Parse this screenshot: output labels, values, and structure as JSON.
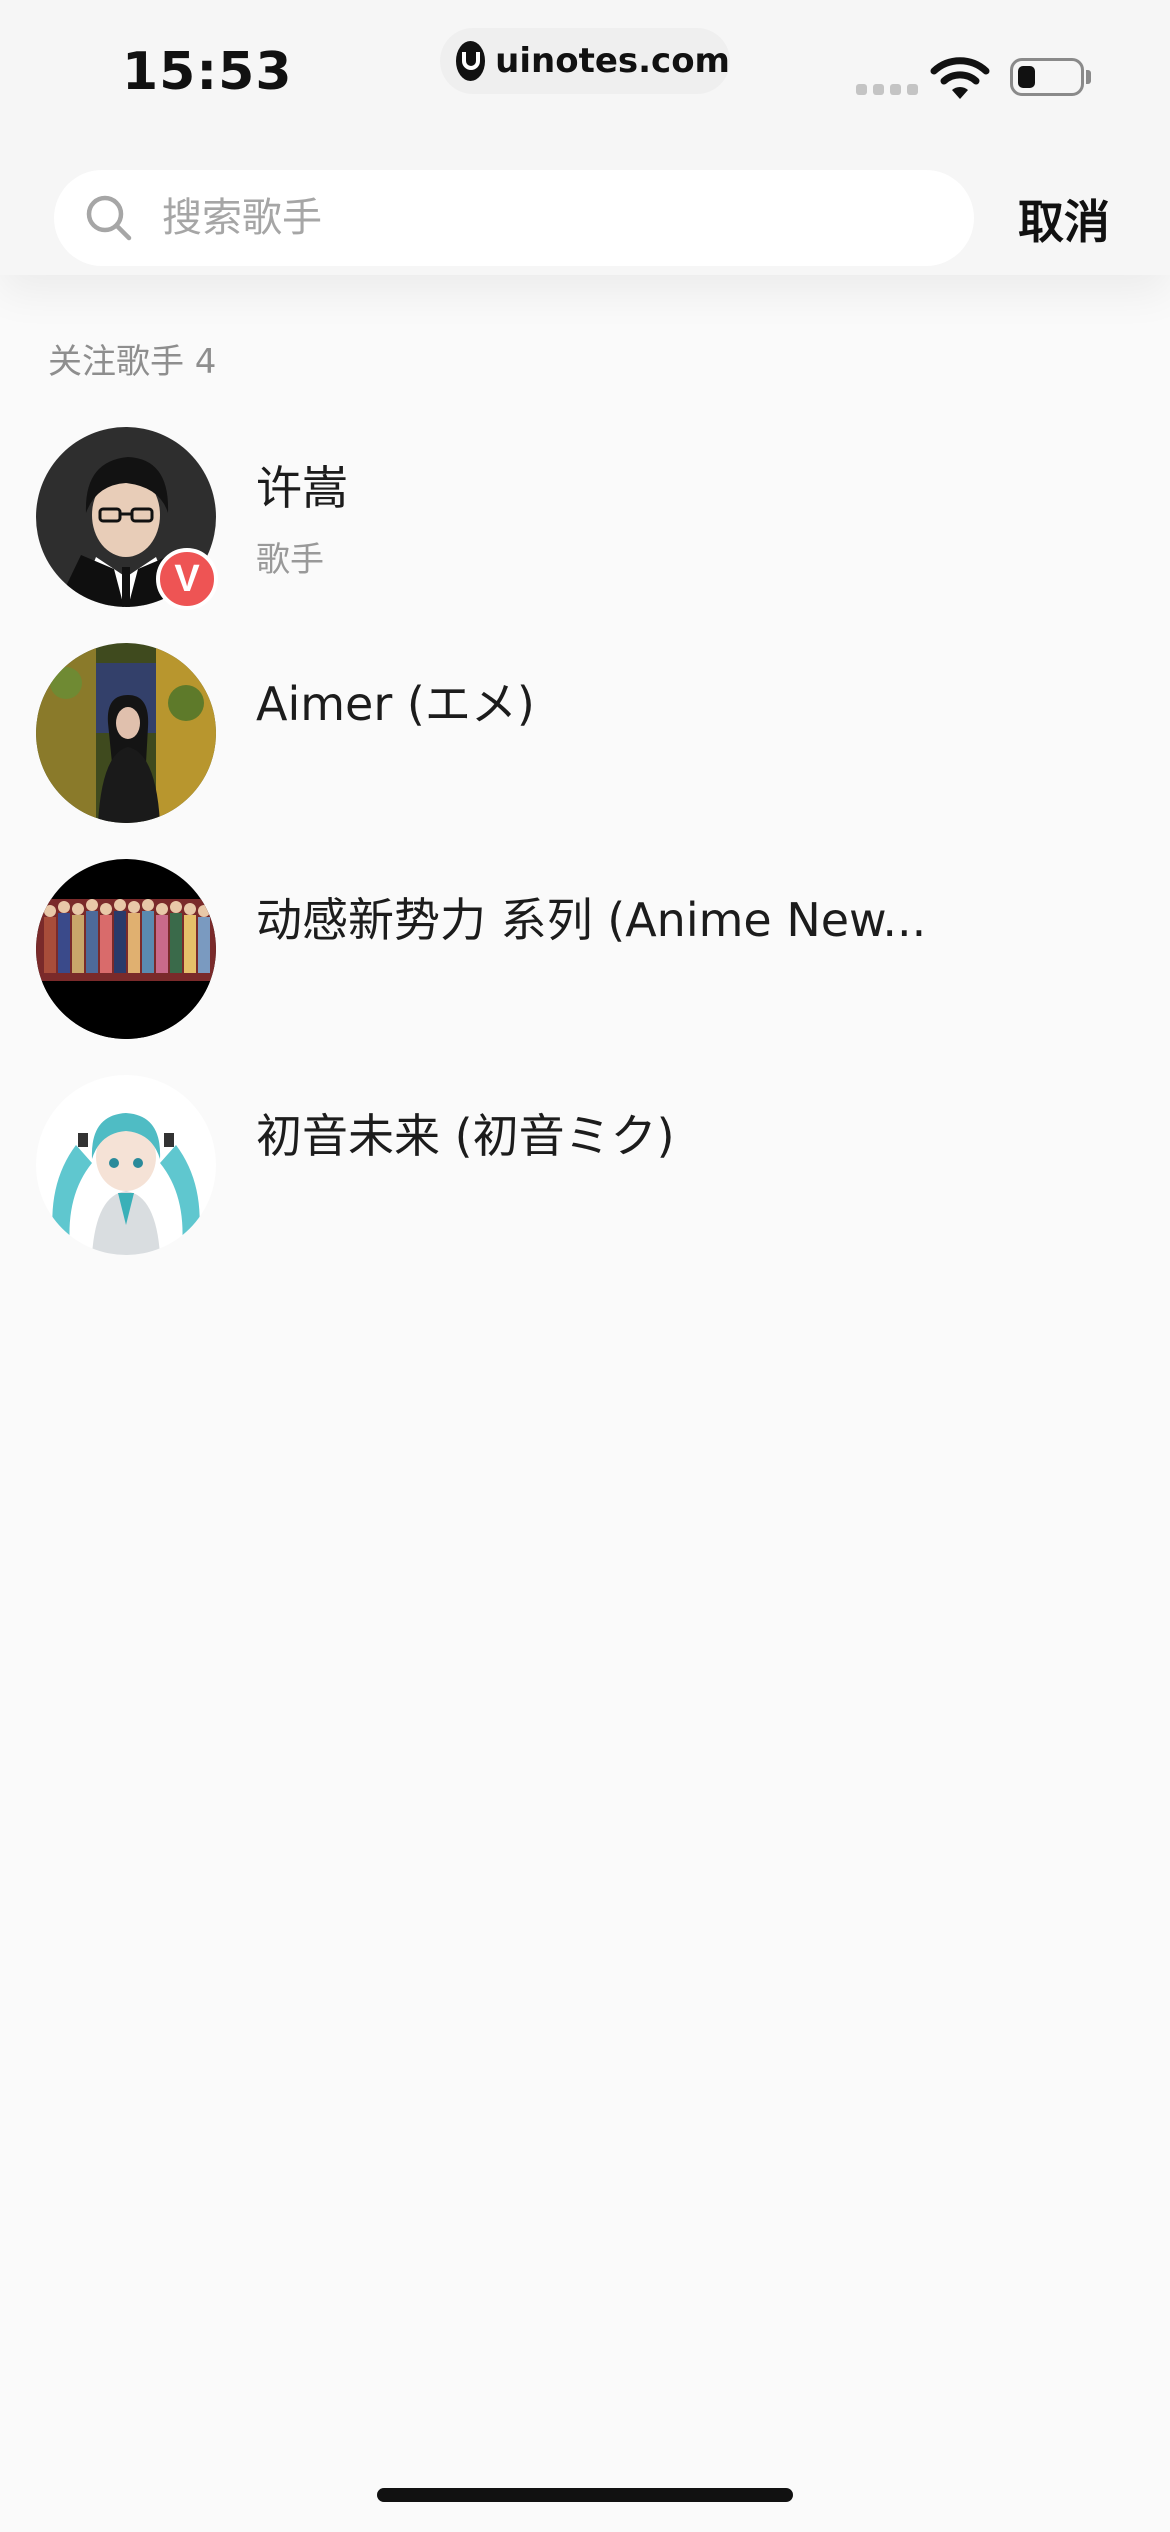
{
  "status_bar": {
    "time": "15:53",
    "url": "uinotes.com",
    "battery_level": 0.3
  },
  "search": {
    "placeholder": "搜索歌手",
    "value": "",
    "cancel_label": "取消"
  },
  "section": {
    "label": "关注歌手 4"
  },
  "singers": [
    {
      "name": "许嵩",
      "subtitle": "歌手",
      "verified": true,
      "verified_badge": "V"
    },
    {
      "name": "Aimer (エメ)"
    },
    {
      "name": "动感新势力 系列 (Anime New..."
    },
    {
      "name": "初音未来 (初音ミク)"
    }
  ],
  "colors": {
    "background": "#fafafa",
    "header": "#f6f6f6",
    "search_box": "#ffffff",
    "verified_badge": "#ee5454",
    "muted_text": "#8e8e8e",
    "primary_text": "#1c1c1c"
  },
  "icons": {
    "search": "search-icon",
    "wifi": "wifi-icon",
    "battery": "battery-icon",
    "verified": "verified-badge-icon"
  }
}
